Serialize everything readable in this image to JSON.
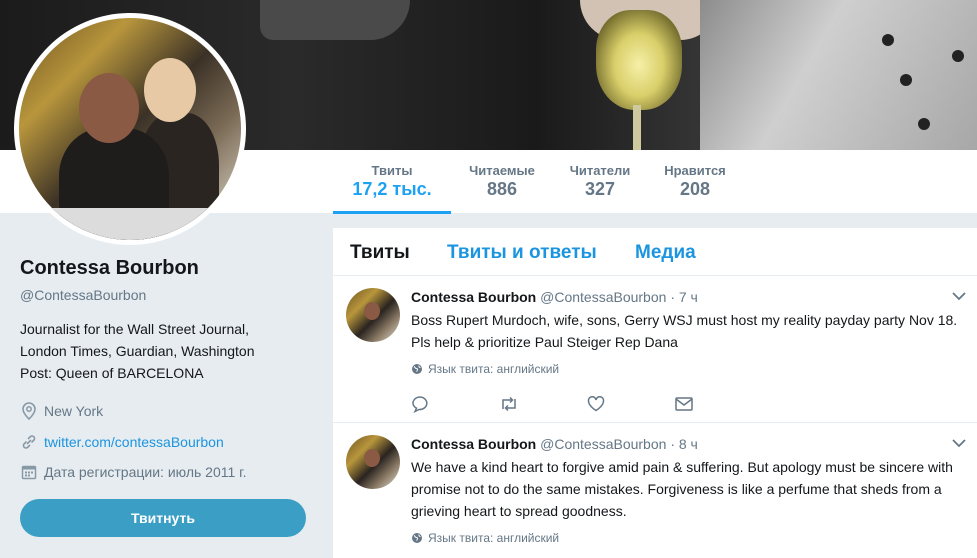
{
  "profile": {
    "name": "Contessa Bourbon",
    "handle": "@ContessaBourbon",
    "bio": "Journalist for the Wall Street Journal, London Times, Guardian, Washington Post: Queen of BARCELONA",
    "location": "New York",
    "url": "twitter.com/contessaBourbon",
    "joined": "Дата регистрации: июль 2011 г.",
    "tweet_button": "Твитнуть"
  },
  "stats": [
    {
      "label": "Твиты",
      "value": "17,2 тыс."
    },
    {
      "label": "Читаемые",
      "value": "886"
    },
    {
      "label": "Читатели",
      "value": "327"
    },
    {
      "label": "Нравится",
      "value": "208"
    }
  ],
  "tabs": [
    "Твиты",
    "Твиты и ответы",
    "Медиа"
  ],
  "tweets": [
    {
      "name": "Contessa Bourbon",
      "handle": "@ContessaBourbon",
      "sep": "·",
      "time": "7 ч",
      "text": "Boss Rupert Murdoch, wife, sons, Gerry WSJ must host my reality payday party Nov 18. Pls help & prioritize Paul Steiger Rep Dana",
      "lang": "Язык твита: английский"
    },
    {
      "name": "Contessa Bourbon",
      "handle": "@ContessaBourbon",
      "sep": "·",
      "time": "8 ч",
      "text": "We have a  kind heart to forgive amid pain & suffering. But apology must be sincere with promise not to do the same mistakes.  Forgiveness is like a perfume that sheds from a grieving heart to spread goodness.",
      "lang": "Язык твита: английский"
    }
  ],
  "colors": {
    "accent": "#1da1f2",
    "link": "#1b95e0",
    "button": "#3b9fc5",
    "muted": "#657786"
  }
}
